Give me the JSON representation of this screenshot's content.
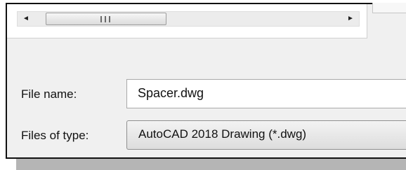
{
  "file_name": {
    "label": "File name:",
    "value": "Spacer.dwg"
  },
  "file_type": {
    "label": "Files of type:",
    "selected": "AutoCAD 2018 Drawing (*.dwg)"
  },
  "scrollbar": {
    "left_arrow": "◄",
    "right_arrow": "►"
  }
}
